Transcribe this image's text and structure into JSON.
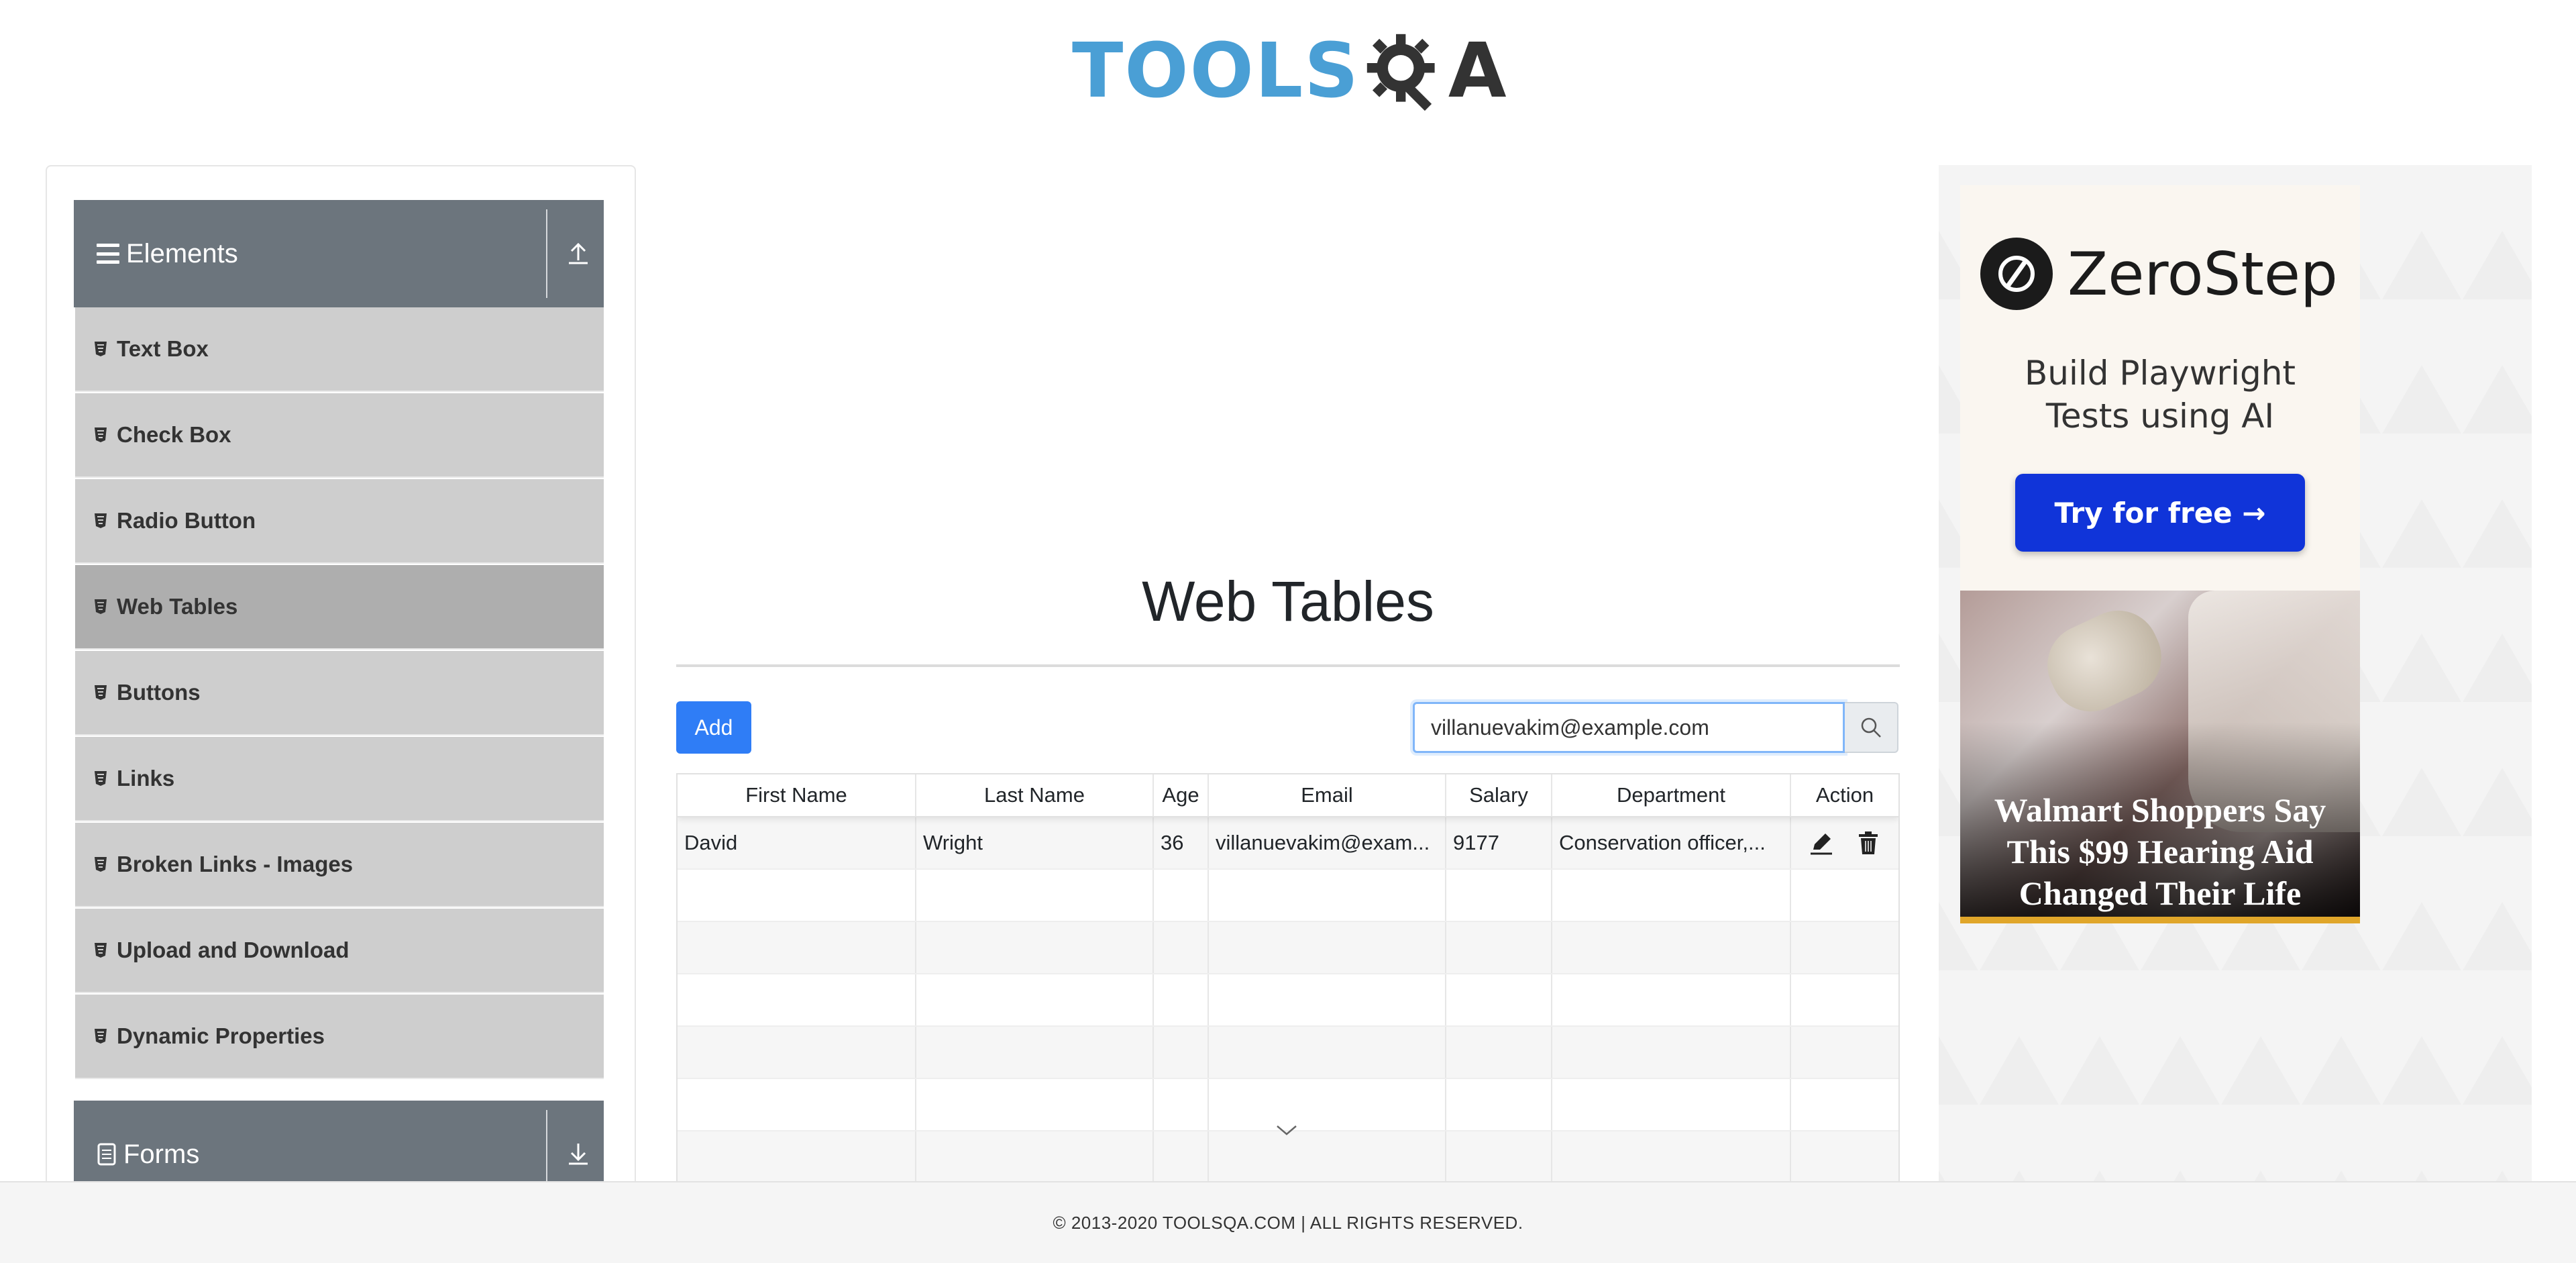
{
  "header": {
    "logo_text_a": "TOOLS",
    "logo_text_b": "A"
  },
  "sidebar": {
    "group_elements": "Elements",
    "items": [
      {
        "label": "Text Box"
      },
      {
        "label": "Check Box"
      },
      {
        "label": "Radio Button"
      },
      {
        "label": "Web Tables",
        "active": true
      },
      {
        "label": "Buttons"
      },
      {
        "label": "Links"
      },
      {
        "label": "Broken Links - Images"
      },
      {
        "label": "Upload and Download"
      },
      {
        "label": "Dynamic Properties"
      }
    ],
    "group_forms": "Forms"
  },
  "main": {
    "title": "Web Tables",
    "add_label": "Add",
    "search": {
      "value": "villanuevakim@example.com",
      "placeholder": "Type to search"
    },
    "table": {
      "headers": [
        "First Name",
        "Last Name",
        "Age",
        "Email",
        "Salary",
        "Department",
        "Action"
      ],
      "rows": [
        {
          "first": "David",
          "last": "Wright",
          "age": "36",
          "email": "villanuevakim@exam...",
          "salary": "9177",
          "department": "Conservation officer,..."
        }
      ]
    }
  },
  "ad": {
    "brand": "ZeroStep",
    "tagline_1": "Build Playwright",
    "tagline_2": "Tests using AI",
    "cta": "Try for free →",
    "headline_1": "Walmart Shoppers Say",
    "headline_2": "This $99 Hearing Aid",
    "headline_3": "Changed Their Life"
  },
  "footer": {
    "text": "© 2013-2020 TOOLSQA.COM | ALL RIGHTS RESERVED."
  },
  "colors": {
    "accent": "#2f7df6",
    "sidebar_header": "#6c757d",
    "sidebar_item": "#cecece",
    "sidebar_active": "#aeaeae",
    "logo_blue": "#4a9fd5"
  }
}
